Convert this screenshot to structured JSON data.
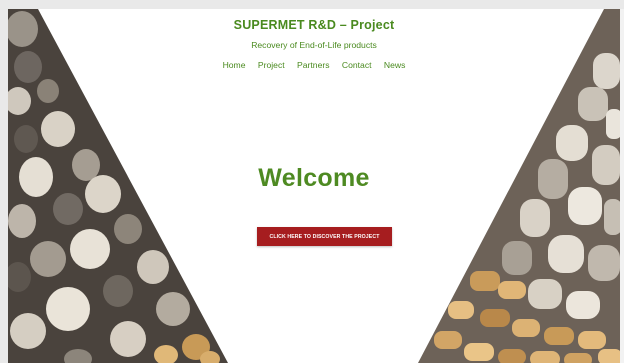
{
  "site": {
    "title": "SUPERMET R&D – Project",
    "tagline": "Recovery of End-of-Life products"
  },
  "nav": [
    {
      "label": "Home"
    },
    {
      "label": "Project"
    },
    {
      "label": "Partners"
    },
    {
      "label": "Contact"
    },
    {
      "label": "News"
    }
  ],
  "hero": {
    "heading": "Welcome",
    "cta_label": "CLICK HERE TO DISCOVER THE PROJECT"
  },
  "colors": {
    "brand_green": "#4a8a1f",
    "cta_red": "#a61d1f"
  }
}
